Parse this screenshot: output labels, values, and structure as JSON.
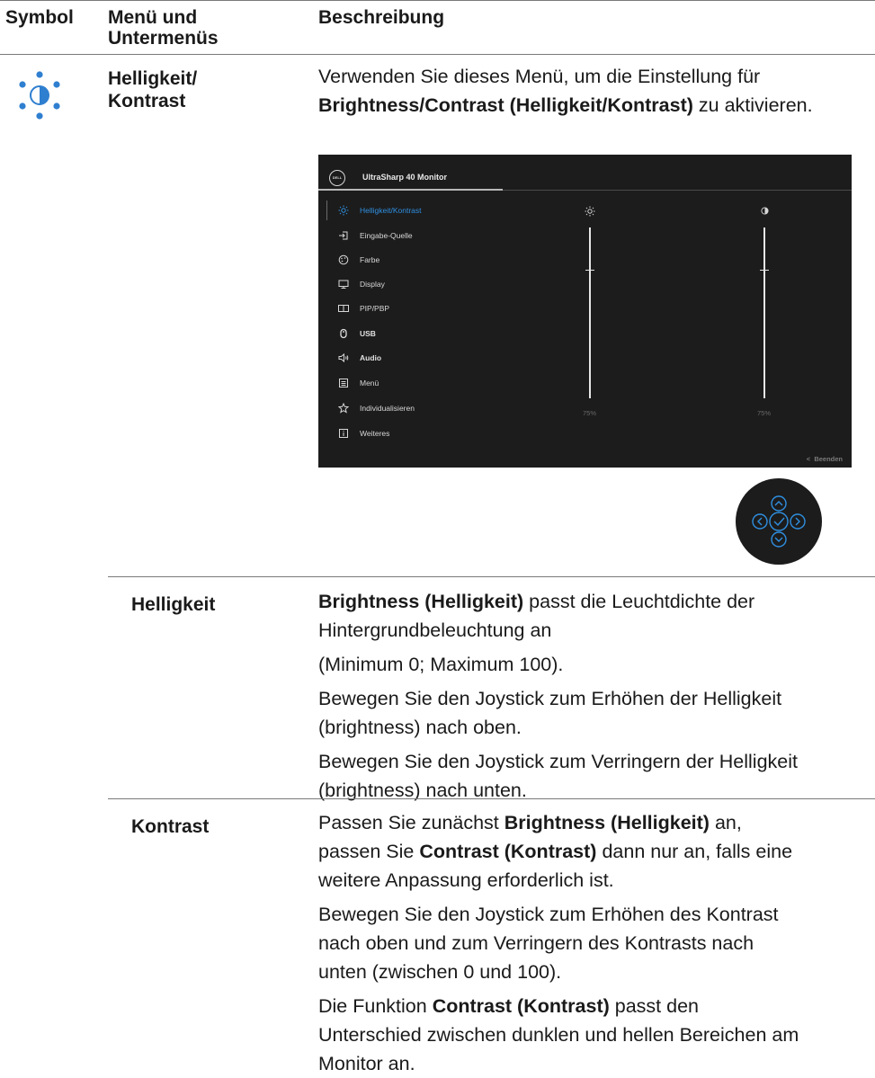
{
  "headers": {
    "symbol": "Symbol",
    "menu": "Menü und Untermenüs",
    "description": "Beschreibung"
  },
  "main_row": {
    "menu_label": "Helligkeit/ Kontrast",
    "desc_part1": "Verwenden Sie dieses Menü, um die Einstellung für",
    "desc_bold": "Brightness/Contrast (Helligkeit/Kontrast)",
    "desc_part2": "zu aktivieren.",
    "icon": "brightness-contrast-icon"
  },
  "osd": {
    "brand_logo": "DELL",
    "title": "UltraSharp 40 Monitor",
    "menu_items": [
      {
        "label": "Helligkeit/Kontrast",
        "icon": "sun-icon",
        "active": true
      },
      {
        "label": "Eingabe-Quelle",
        "icon": "input-icon"
      },
      {
        "label": "Farbe",
        "icon": "palette-icon"
      },
      {
        "label": "Display",
        "icon": "display-icon"
      },
      {
        "label": "PIP/PBP",
        "icon": "pip-icon"
      },
      {
        "label": "USB",
        "icon": "mouse-icon"
      },
      {
        "label": "Audio",
        "icon": "speaker-icon"
      },
      {
        "label": "Menü",
        "icon": "menu-icon"
      },
      {
        "label": "Individualisieren",
        "icon": "star-icon"
      },
      {
        "label": "Weiteres",
        "icon": "info-icon"
      }
    ],
    "brightness_value": "75%",
    "contrast_value": "75%",
    "brightness_level": 0.75,
    "contrast_level": 0.75,
    "exit_label": "Beenden",
    "accent_color": "#2f8fe0"
  },
  "helligkeit": {
    "label": "Helligkeit",
    "bold": "Brightness (Helligkeit)",
    "line1_rest": "passt die Leuchtdichte der",
    "line2": "Hintergrundbeleuchtung an",
    "line3": "(Minimum 0; Maximum 100).",
    "p2a": "Bewegen Sie den Joystick zum Erhöhen der Helligkeit",
    "p2b": "(brightness) nach oben.",
    "p3a": "Bewegen Sie den Joystick zum Verringern der Helligkeit",
    "p3b": "(brightness) nach unten."
  },
  "kontrast": {
    "label": "Kontrast",
    "p1_pre": "Passen Sie zunächst",
    "p1_bold1": "Brightness (Helligkeit)",
    "p1_after1": "an,",
    "p1_l2_pre": "passen Sie",
    "p1_bold2": "Contrast (Kontrast)",
    "p1_l2_post": "dann nur an, falls eine",
    "p1_l3": "weitere Anpassung erforderlich ist.",
    "p2_l1": "Bewegen Sie den Joystick zum Erhöhen des Kontrast",
    "p2_l2": "nach oben und zum Verringern des Kontrasts nach",
    "p2_l3": "unten (zwischen 0 und 100).",
    "p3_pre": "Die Funktion",
    "p3_bold": "Contrast (Kontrast)",
    "p3_post": "passt den",
    "p3_l2": "Unterschied zwischen dunklen und hellen Bereichen am",
    "p3_l3": "Monitor an."
  }
}
